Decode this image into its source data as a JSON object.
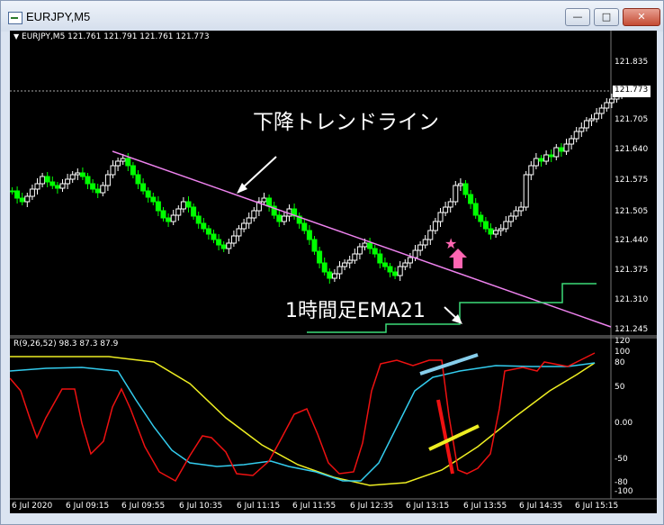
{
  "window": {
    "title": "EURJPY,M5",
    "buttons": {
      "minimize": "—",
      "maximize": "□",
      "close": "✕"
    }
  },
  "main_panel": {
    "symbol_info": "EURJPY,M5  121.761 121.791 121.761 121.773",
    "current_price": "121.773",
    "price_axis": [
      "121.835",
      "121.770",
      "121.705",
      "121.640",
      "121.575",
      "121.505",
      "121.440",
      "121.375",
      "121.310",
      "121.245"
    ],
    "annotations": {
      "trendline_label": "下降トレンドライン",
      "ema_label": "1時間足EMA21"
    }
  },
  "sub_panel": {
    "indicator_label": "R(9,26,52) 98.3 87.3 87.9",
    "axis": [
      "120",
      "100",
      "80",
      "50",
      "0.00",
      "-50",
      "-80",
      "-100"
    ]
  },
  "time_axis": [
    "6 Jul 2020",
    "6 Jul 09:15",
    "6 Jul 09:55",
    "6 Jul 10:35",
    "6 Jul 11:15",
    "6 Jul 11:55",
    "6 Jul 12:35",
    "6 Jul 13:15",
    "6 Jul 13:55",
    "6 Jul 14:35",
    "6 Jul 15:15"
  ],
  "colors": {
    "background": "#000000",
    "bull_candle": "#ffffff",
    "bear_candle": "#00ff00",
    "trendline": "#ee82ee",
    "ema": "#3cdc78",
    "rci_short": "#ee1111",
    "rci_mid": "#33ccee",
    "rci_long": "#eeee22",
    "markers": "#ff66b2"
  }
}
